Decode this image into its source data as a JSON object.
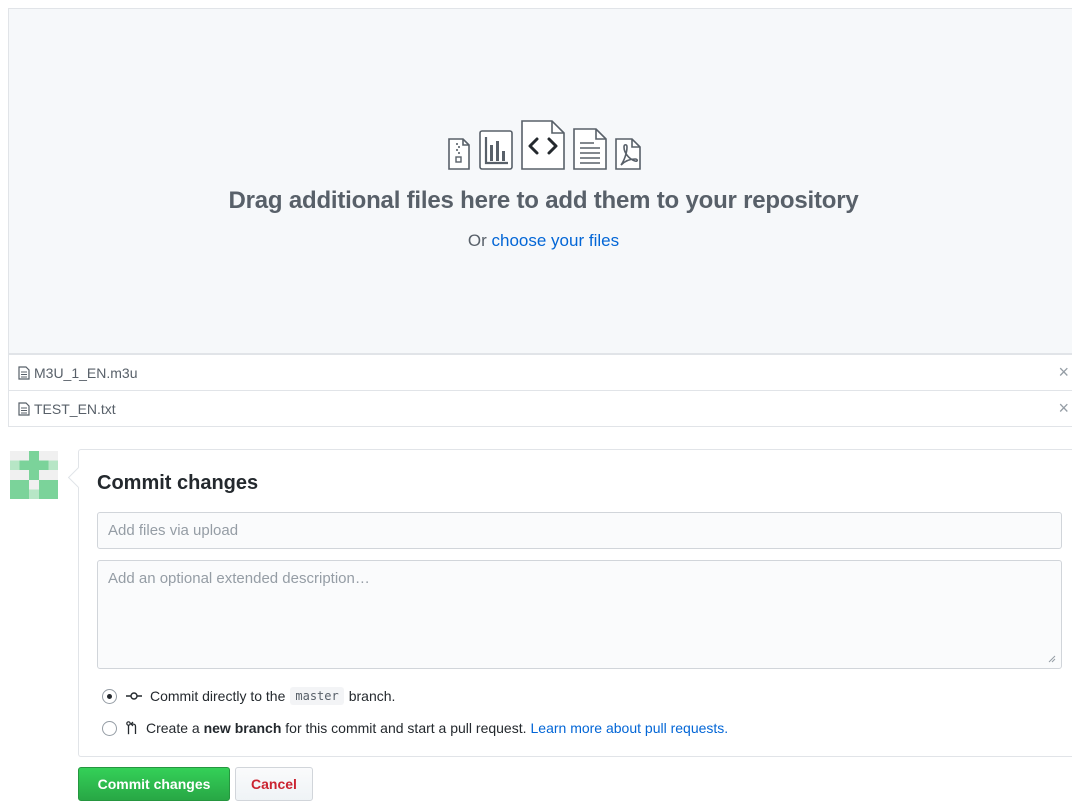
{
  "dropzone": {
    "icons": [
      "file-zip-icon",
      "graph-icon",
      "file-code-icon",
      "file-text-icon",
      "file-pdf-icon"
    ],
    "title": "Drag additional files here to add them to your repository",
    "sub_prefix": "Or ",
    "choose_link": "choose your files"
  },
  "files": [
    {
      "name": "M3U_1_EN.m3u",
      "icon": "file-icon",
      "remove": "×"
    },
    {
      "name": "TEST_EN.txt",
      "icon": "file-icon",
      "remove": "×"
    }
  ],
  "commit": {
    "title": "Commit changes",
    "summary_placeholder": "Add files via upload",
    "description_placeholder": "Add an optional extended description…",
    "option_direct": {
      "prefix": "Commit directly to the",
      "branch": "master",
      "suffix": "branch.",
      "selected": true
    },
    "option_new_branch": {
      "prefix": "Create a",
      "bold": "new branch",
      "suffix": "for this commit and start a pull request.",
      "link": "Learn more about pull requests.",
      "selected": false
    },
    "submit_label": "Commit changes",
    "cancel_label": "Cancel"
  },
  "colors": {
    "accent_link": "#0366d6",
    "commit_green": "#28a745",
    "cancel_red": "#cb2431",
    "avatar_green": "#7bd39a"
  }
}
